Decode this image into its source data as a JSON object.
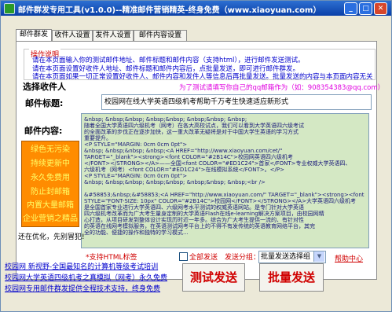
{
  "window": {
    "title": "邮件群发专用工具(v1.0.0)--精准邮件营销精英-终身免费（www.xiaoyuan.com）",
    "buttons": {
      "minimize": "_",
      "maximize": "□",
      "close": "✕"
    }
  },
  "tabs": [
    "邮件群发",
    "收件人设置",
    "发件人设置",
    "邮件内容设置"
  ],
  "notice": {
    "title": "操作说明",
    "lines": [
      "请在本页面输入你的测试邮件地址、邮件标题和邮件内容（支持html），进行邮件发送测试。",
      "请在本页面设置好收件人地址、邮件标题和邮件内容后，点批量发送，即可进行邮件群发。",
      "请在本页面如果一切正常设置好收件人、邮件内容和发件人等信息后再批量发送。批量发送的内容与本页面内容无关"
    ]
  },
  "recipient": {
    "label": "选择收件人",
    "hint": "为了测试请填写你自己的qq邮箱作为（如：908354383@qq.com）"
  },
  "subject": {
    "label": "邮件标题:",
    "value": "校园网在线大学英语四级机考帮助千万考生快速适应新形式"
  },
  "content": {
    "label": "邮件内容:",
    "lines": [
      "&nbsp; &nbsp;&nbsp; &nbsp;&nbsp; &nbsp;&nbsp; &nbsp;",
      "随着全国大学英语四六级机考（网考）在各大高校试点，我们可以看到大学英语四六级考试",
      "的全面改革的步伐正在逐步加快，这一重大改革无疑将是对于中国大学生英语的学习方式",
      "重要提升。",
      "<P STYLE=\"MARGIN: 0cm 0cm 0pt\">",
      "&nbsp; &nbsp;&nbsp; &nbsp;<A HREF=\"http://www.xiaoyuan.com/cet/\"",
      "TARGET=\"_blank\"><strong><font COLOR=\"#2B14C\">校园网英语四六级机考",
      "</FONT></STRONG></A>——全国<font COLOR=\"#ED1C24\">首家</FONT>专业权威大学英语四、",
      "六级机考（网考）<font COLOR=\"#ED1C24\">在线模拟系统</FONT>。</P>",
      "<P STYLE=\"MARGIN: 0cm 0cm 0pt\">",
      "&nbsp; &nbsp;&nbsp; &nbsp;&nbsp; &nbsp;&nbsp; &nbsp;<br />",
      "",
      "&#58853;&nbsp;&#58853;<A HREF=\"http://www.xiaoyuan.com/\" TARGET=\"_blank\"><strong><font",
      "STYLE=\"FONT-SIZE: 10px\" COLOR=\"#2B14C\">校园网</FONT></STRONG></A>大学英语四六级机考",
      "是全国首家专业进行大学英语四、六级网考水平测试的权威英语网站。是专门针对大学英语",
      "四六级机考改革而为广大考生量身定制的大学英语Flash在线e-learning解决方案项目，由校园网精",
      "心打造，从项目研发到整体设计实现历时近一年多。综合为广大考生提供一流的、有针对性",
      "的英语在线网考模拟服务，在英语测试网考平台上的不得不有发传统的英语教育网络平台，其完",
      "全的功能、便捷的操作和独特的学习模式..."
    ]
  },
  "side_panel": {
    "items": [
      "绿色无污染",
      "持续更新中",
      "永久免费用",
      "防止封邮箱",
      "内置大量邮箱",
      "企业营销之精品"
    ],
    "optimizing_text": "还在优化，先别冒犯!"
  },
  "html_support_label": "*支持HTML标签",
  "send_controls": {
    "select_all_label": "全部发送",
    "group_label": "发送分组：",
    "group_select_value": "批量发送选择组",
    "dropdown_icon": "▼",
    "help_label": "帮助中心",
    "test_send_label": "测试发送",
    "batch_send_label": "批量发送"
  },
  "bottom_links": [
    "校园网 新视野-全国最知名的计算机等级考试培训",
    "校园网大学英语四级机考之真模拟（网考）永久免费",
    "校园网专用邮件群发提供全程技术支持，终身免费"
  ]
}
